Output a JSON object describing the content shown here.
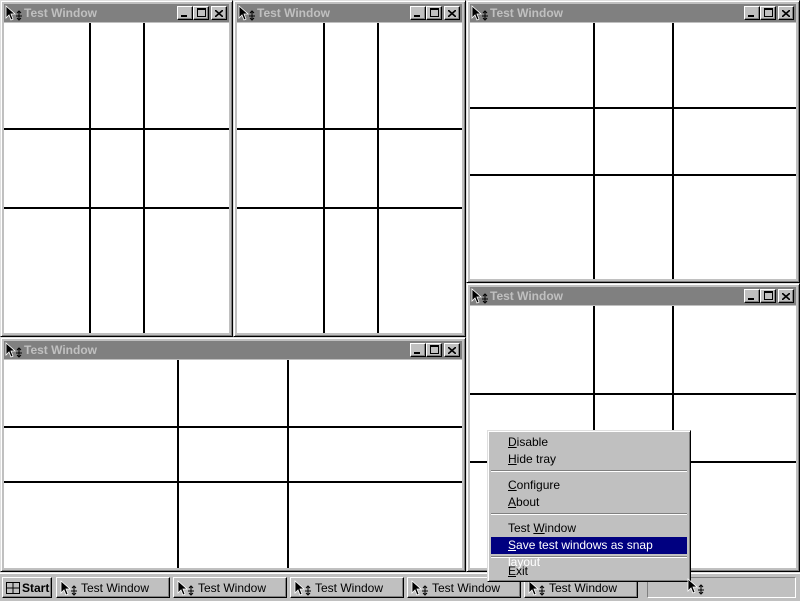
{
  "windows": [
    {
      "title": "Test Window"
    },
    {
      "title": "Test Window"
    },
    {
      "title": "Test Window"
    },
    {
      "title": "Test Window"
    },
    {
      "title": "Test Window"
    }
  ],
  "taskbar": {
    "start_label": "Start",
    "buttons": [
      {
        "label": "Test Window"
      },
      {
        "label": "Test Window"
      },
      {
        "label": "Test Window"
      },
      {
        "label": "Test Window"
      },
      {
        "label": "Test Window"
      }
    ]
  },
  "context_menu": {
    "items": [
      {
        "first": "D",
        "rest": "isable"
      },
      {
        "first": "H",
        "rest": "ide tray"
      },
      {
        "first": "C",
        "rest": "onfigure"
      },
      {
        "first": "A",
        "rest": "bout"
      },
      {
        "pre": "Test ",
        "mid": "W",
        "post": "indow"
      },
      {
        "first": "S",
        "rest": "ave test windows as snap layout"
      },
      {
        "first": "E",
        "rest": "xit"
      }
    ]
  },
  "icons": {
    "window": "move-cursor-icon",
    "minimize": "minimize-icon",
    "maximize": "maximize-icon",
    "close": "close-icon",
    "start": "windows-logo-icon"
  },
  "colors": {
    "inactive_title": "#808080",
    "menu_highlight": "#000080",
    "face": "#c0c0c0"
  }
}
